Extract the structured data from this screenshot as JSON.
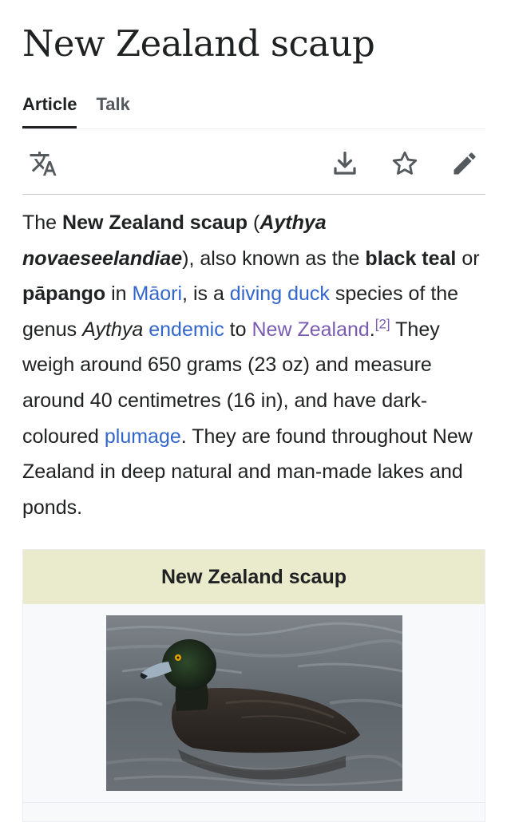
{
  "page": {
    "title": "New Zealand scaup"
  },
  "tabs": [
    {
      "label": "Article",
      "active": true
    },
    {
      "label": "Talk",
      "active": false
    }
  ],
  "toolbar": {
    "icons": [
      "language-icon",
      "download-icon",
      "star-icon",
      "edit-icon"
    ]
  },
  "lead": {
    "t1": "The ",
    "b1": "New Zealand scaup",
    "t2": " (",
    "bi1": "Aythya novaeseelandiae",
    "t3": "), also known as the ",
    "b2": "black teal",
    "t4": " or ",
    "b3": "pāpango",
    "t5": " in ",
    "link_maori": "Māori",
    "t6": ", is a ",
    "link_diving_duck": "diving duck",
    "t7": " species of the genus ",
    "i1": "Aythya",
    "t8": " ",
    "link_endemic": "endemic",
    "t9": " to ",
    "link_new_zealand": "New Zealand",
    "t10": ".",
    "ref": "[2]",
    "t11": " They weigh around 650 grams (23 oz) and measure around 40 centimetres (16 in), and have dark-coloured ",
    "link_plumage": "plumage",
    "t12": ". They are found throughout New Zealand in deep natural and man-made lakes and ponds."
  },
  "infobox": {
    "title": "New Zealand scaup"
  },
  "colors": {
    "link": "#3366cc",
    "visited_link": "#795cb2",
    "infobox_header": "#eaeacc",
    "text": "#202122"
  }
}
